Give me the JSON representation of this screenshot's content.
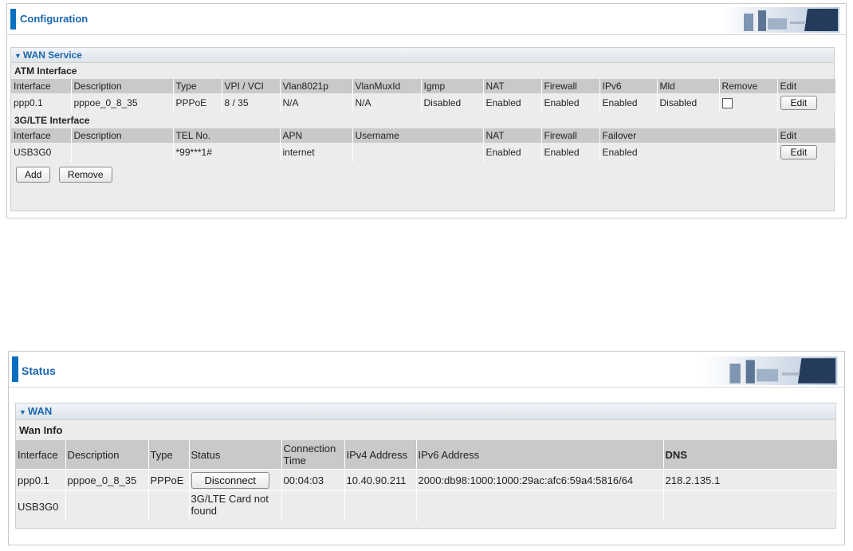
{
  "config": {
    "title": "Configuration",
    "section_title": "WAN Service",
    "atm": {
      "title": "ATM Interface",
      "columns": [
        "Interface",
        "Description",
        "Type",
        "VPI / VCI",
        "Vlan8021p",
        "VlanMuxId",
        "Igmp",
        "NAT",
        "Firewall",
        "IPv6",
        "Mld",
        "Remove",
        "Edit"
      ],
      "rows": [
        {
          "interface": "ppp0.1",
          "description": "pppoe_0_8_35",
          "type": "PPPoE",
          "vpi_vci": "8 / 35",
          "vlan8021p": "N/A",
          "vlanmuxid": "N/A",
          "igmp": "Disabled",
          "nat": "Enabled",
          "firewall": "Enabled",
          "ipv6": "Enabled",
          "mld": "Disabled",
          "edit_label": "Edit"
        }
      ]
    },
    "lte": {
      "title": "3G/LTE Interface",
      "columns": [
        "Interface",
        "Description",
        "TEL No.",
        "APN",
        "Username",
        "NAT",
        "Firewall",
        "Failover",
        "Edit"
      ],
      "rows": [
        {
          "interface": "USB3G0",
          "description": "",
          "tel": "*99***1#",
          "apn": "internet",
          "username": "",
          "nat": "Enabled",
          "firewall": "Enabled",
          "failover": "Enabled",
          "edit_label": "Edit"
        }
      ]
    },
    "add_label": "Add",
    "remove_label": "Remove"
  },
  "status": {
    "title": "Status",
    "section_title": "WAN",
    "sub_title": "Wan Info",
    "columns": [
      "Interface",
      "Description",
      "Type",
      "Status",
      "Connection Time",
      "IPv4 Address",
      "IPv6 Address",
      "DNS"
    ],
    "rows": [
      {
        "interface": "ppp0.1",
        "description": "pppoe_0_8_35",
        "type": "PPPoE",
        "status_button": "Disconnect",
        "connection_time": "00:04:03",
        "ipv4": "10.40.90.211",
        "ipv6": "2000:db98:1000:1000:29ac:afc6:59a4:5816/64",
        "dns": "218.2.135.1"
      },
      {
        "interface": "USB3G0",
        "description": "",
        "type": "",
        "status_text": "3G/LTE Card not found",
        "connection_time": "",
        "ipv4": "",
        "ipv6": "",
        "dns": ""
      }
    ]
  },
  "colors": {
    "accent": "#0b6fbf",
    "title_text": "#1a66b0",
    "header_row": "#c9c9c9",
    "row_bg": "#ececec"
  }
}
